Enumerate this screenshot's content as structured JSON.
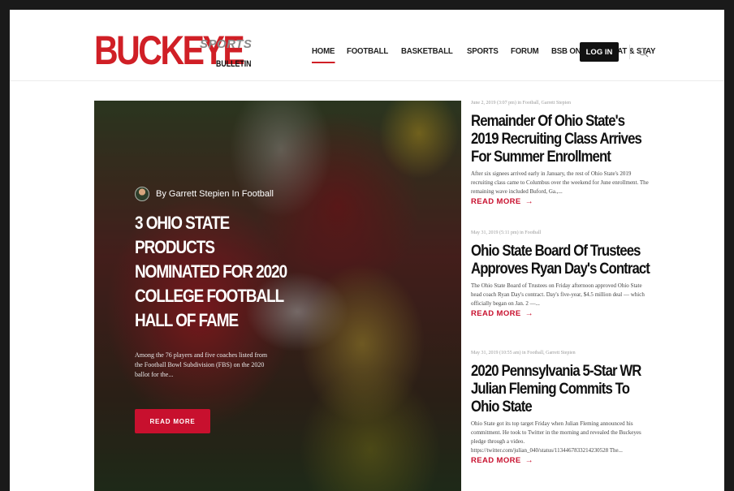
{
  "brand": {
    "logo_main": "BUCKEYE",
    "logo_sports": "SPORTS",
    "logo_bulletin": "BULLETIN"
  },
  "nav": {
    "items": [
      "HOME",
      "FOOTBALL",
      "BASKETBALL",
      "SPORTS",
      "FORUM",
      "BSB ONLINE",
      "EAT & STAY"
    ],
    "active": "HOME",
    "login_label": "LOG IN",
    "search_icon": "search-icon"
  },
  "hero": {
    "author_line": "By Garrett Stepien In Football",
    "title": "3 Ohio State Products Nominated For 2020 College Football Hall Of Fame",
    "excerpt": "Among the 76 players and five coaches listed from the Football Bowl Subdivision (FBS) on the 2020 ballot for the...",
    "button_label": "READ MORE"
  },
  "articles": [
    {
      "meta": "June 2, 2019 (3:07 pm) in Football, Garrett Stepien",
      "title": "Remainder Of Ohio State's 2019 Recruiting Class Arrives For Summer Enrollment",
      "excerpt": "After six signees arrived early in January, the rest of Ohio State's 2019 recruiting class came to Columbus over the weekend for June enrollment. The remaining wave included Buford, Ga.,...",
      "read_more": "READ MORE"
    },
    {
      "meta": "May 31, 2019 (5:11 pm) in Football",
      "title": "Ohio State Board Of Trustees Approves Ryan Day's Contract",
      "excerpt": "The Ohio State Board of Trustees on Friday afternoon approved Ohio State head coach Ryan Day's contract. Day's five-year, $4.5 million deal — which officially began on Jan. 2 —...",
      "read_more": "READ MORE"
    },
    {
      "meta": "May 31, 2019 (10:55 am) in Football, Garrett Stepien",
      "title": "2020 Pennsylvania 5-Star WR Julian Fleming Commits To Ohio State",
      "excerpt": "Ohio State got its top target Friday when Julian Fleming announced his commitment. He took to Twitter in the morning and revealed the Buckeyes pledge through a video. https://twitter.com/julian_040/status/1134467833214230528 The...",
      "read_more": "READ MORE"
    }
  ],
  "colors": {
    "accent": "#c8102e",
    "logo_red": "#d01f26",
    "login_bg": "#111111"
  }
}
